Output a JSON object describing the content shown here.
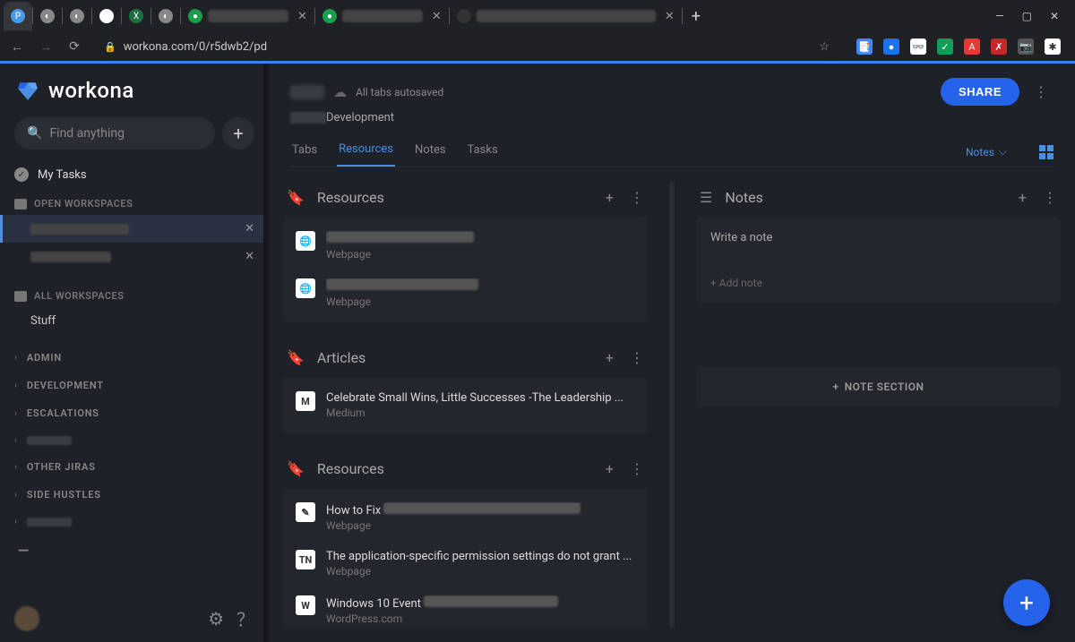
{
  "browser": {
    "tabs": [
      {
        "icon_bg": "#4799eb",
        "icon_text": "P"
      },
      {
        "icon_bg": "#888",
        "icon_text": "◐"
      },
      {
        "icon_bg": "#888",
        "icon_text": "◐"
      },
      {
        "icon_bg": "#fff",
        "icon_text": "G"
      },
      {
        "icon_bg": "#1d6f42",
        "icon_text": "X"
      },
      {
        "icon_bg": "#888",
        "icon_text": "◐"
      },
      {
        "icon_bg": "#1a9e4b",
        "icon_text": "●",
        "closable": true
      },
      {
        "icon_bg": "#1a9e4b",
        "icon_text": "●",
        "closable": true
      },
      {
        "icon_bg": "#333",
        "wide": true,
        "closable": true
      }
    ],
    "url": "workona.com/0/r5dwb2/pd",
    "ext_icons": [
      {
        "bg": "#4285f4",
        "t": "📑"
      },
      {
        "bg": "#1a73e8",
        "t": "●"
      },
      {
        "bg": "#fff",
        "t": "👓"
      },
      {
        "bg": "#0f9d58",
        "t": "✓"
      },
      {
        "bg": "#e53935",
        "t": "A"
      },
      {
        "bg": "#c62828",
        "t": "✗"
      },
      {
        "bg": "#555",
        "t": "📷"
      },
      {
        "bg": "#fff",
        "t": "✱"
      }
    ]
  },
  "logo_text": "workona",
  "search_placeholder": "Find anything",
  "sidebar": {
    "mytasks": "My Tasks",
    "open_ws_header": "OPEN WORKSPACES",
    "all_ws_header": "ALL WORKSPACES",
    "all_ws_item": "Stuff",
    "categories": [
      {
        "label": "ADMIN"
      },
      {
        "label": "DEVELOPMENT"
      },
      {
        "label": "ESCALATIONS"
      },
      {
        "label": "",
        "blur": true
      },
      {
        "label": "OTHER JIRAS"
      },
      {
        "label": "SIDE HUSTLES"
      },
      {
        "label": "",
        "blur": true
      }
    ]
  },
  "header": {
    "autosave": "All tabs autosaved",
    "workspace_suffix": "Development",
    "share": "SHARE",
    "tabs": [
      "Tabs",
      "Resources",
      "Notes",
      "Tasks"
    ],
    "active_tab": 1,
    "notes_dropdown": "Notes"
  },
  "resources": {
    "section1_title": "Resources",
    "section1_items": [
      {
        "icon": "🌐",
        "title_blur_w": 165,
        "sub": "Webpage"
      },
      {
        "icon": "🌐",
        "title_blur_w": 170,
        "sub": "Webpage"
      }
    ],
    "section2_title": "Articles",
    "section2_items": [
      {
        "icon": "M",
        "title": "Celebrate Small Wins, Little Successes -The Leadership ...",
        "sub": "Medium"
      }
    ],
    "section3_title": "Resources",
    "section3_items": [
      {
        "icon": "✎",
        "title": "How to Fix",
        "title_blur_w": 220,
        "sub": "Webpage"
      },
      {
        "icon": "TN",
        "title": "The application-specific permission settings do not grant ...",
        "sub": "Webpage"
      },
      {
        "icon": "W",
        "title": "Windows 10 Event",
        "title_blur_w": 150,
        "sub": "WordPress.com"
      }
    ]
  },
  "notes": {
    "title": "Notes",
    "write_placeholder": "Write a note",
    "add_note": "+ Add note",
    "note_section": "NOTE SECTION"
  }
}
